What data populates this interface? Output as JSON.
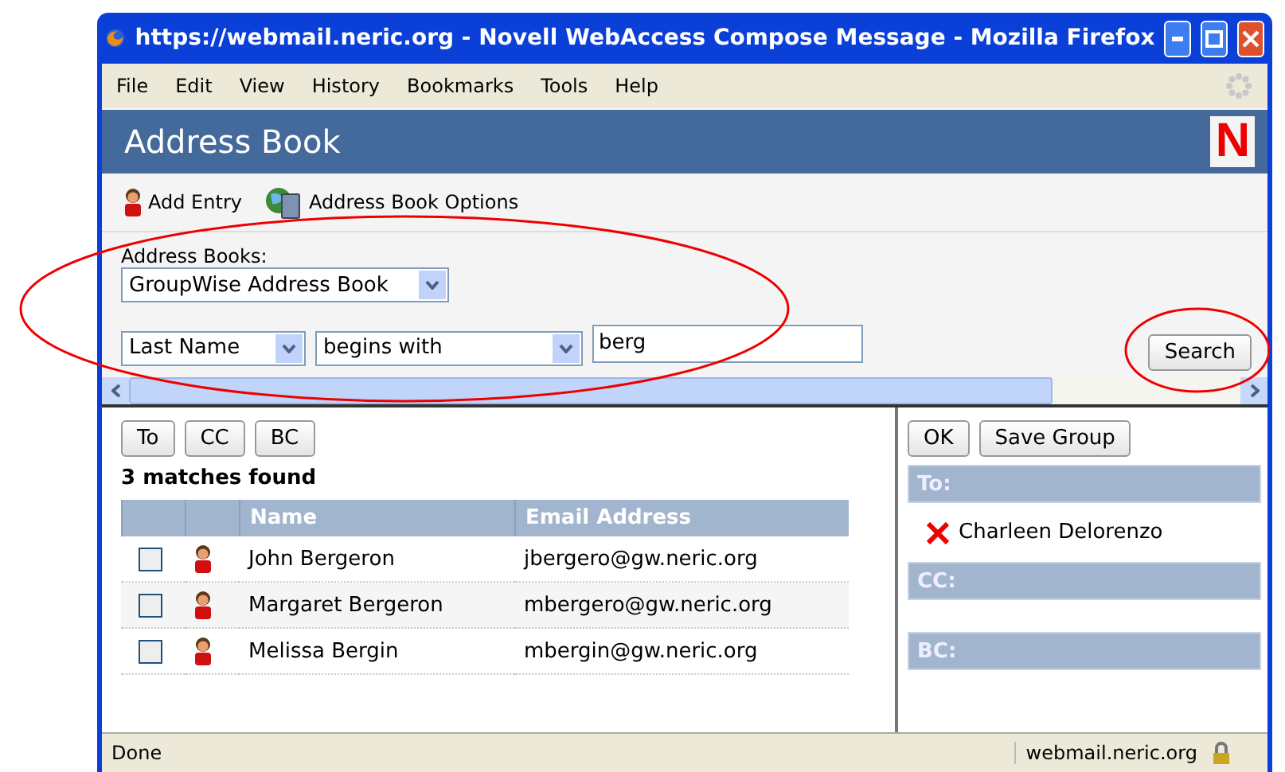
{
  "window": {
    "title": "https://webmail.neric.org - Novell WebAccess Compose Message - Mozilla Firefox"
  },
  "menu": [
    "File",
    "Edit",
    "View",
    "History",
    "Bookmarks",
    "Tools",
    "Help"
  ],
  "header": {
    "title": "Address Book",
    "logo": "N"
  },
  "toolbar": [
    {
      "kind": "person",
      "label": "Add Entry"
    },
    {
      "kind": "book",
      "label": "Address Book Options"
    }
  ],
  "search": {
    "books_label": "Address Books:",
    "book": "GroupWise Address Book",
    "field": "Last Name",
    "operator": "begins with",
    "value": "berg",
    "button": "Search"
  },
  "results": {
    "buttons": [
      "To",
      "CC",
      "BC"
    ],
    "count": "3 matches found",
    "columns": [
      "Name",
      "Email Address"
    ],
    "rows": [
      {
        "name": "John Bergeron",
        "email": "jbergero@gw.neric.org",
        "checked": false
      },
      {
        "name": "Margaret Bergeron",
        "email": "mbergero@gw.neric.org",
        "checked": false
      },
      {
        "name": "Melissa Bergin",
        "email": "mbergin@gw.neric.org",
        "checked": false
      }
    ]
  },
  "recipients": {
    "buttons": [
      "OK",
      "Save Group"
    ],
    "sections": [
      {
        "label": "To:",
        "names": [
          "Charleen Delorenzo"
        ]
      },
      {
        "label": "CC:"
      },
      {
        "label": "BC:"
      }
    ]
  },
  "status_bar": {
    "text": "Done",
    "host": "webmail.neric.org"
  }
}
